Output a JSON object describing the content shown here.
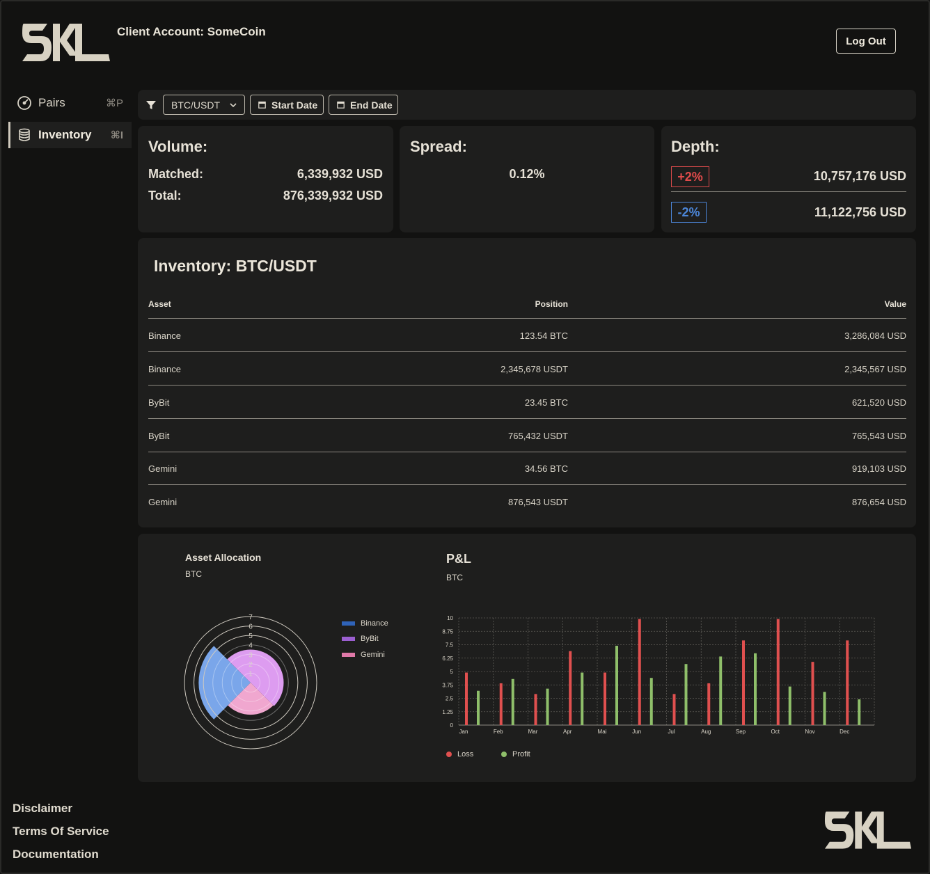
{
  "header": {
    "logo_text": "SKL",
    "client_account": "Client Account: SomeCoin",
    "logout_label": "Log Out"
  },
  "sidebar": {
    "items": [
      {
        "label": "Pairs",
        "shortcut": "⌘P",
        "icon": "gauge-icon",
        "active": false
      },
      {
        "label": "Inventory",
        "shortcut": "⌘I",
        "icon": "database-icon",
        "active": true
      }
    ]
  },
  "footer": {
    "links": [
      "Disclaimer",
      "Terms Of Service",
      "Documentation"
    ],
    "logo_text": "SKL"
  },
  "filters": {
    "pair_value": "BTC/USDT",
    "start_label": "Start Date",
    "end_label": "End Date"
  },
  "volume": {
    "title": "Volume:",
    "matched_label": "Matched:",
    "matched_value": "6,339,932 USD",
    "total_label": "Total:",
    "total_value": "876,339,932 USD"
  },
  "spread": {
    "title": "Spread:",
    "value": "0.12%"
  },
  "depth": {
    "title": "Depth:",
    "up_badge": "+2%",
    "up_value": "10,757,176  USD",
    "down_badge": "-2%",
    "down_value": "11,122,756  USD"
  },
  "inventory": {
    "title": "Inventory: BTC/USDT",
    "columns": [
      "Asset",
      "Position",
      "Value"
    ],
    "rows": [
      {
        "asset": "Binance",
        "position": "123.54 BTC",
        "value": "3,286,084 USD"
      },
      {
        "asset": "Binance",
        "position": "2,345,678 USDT",
        "value": "2,345,567 USD"
      },
      {
        "asset": "ByBit",
        "position": "23.45 BTC",
        "value": "621,520 USD"
      },
      {
        "asset": "ByBit",
        "position": "765,432 USDT",
        "value": "765,543 USD"
      },
      {
        "asset": "Gemini",
        "position": "34.56 BTC",
        "value": "919,103 USD"
      },
      {
        "asset": "Gemini",
        "position": "876,543 USDT",
        "value": "876,654 USD"
      }
    ]
  },
  "colors": {
    "accent": "#d8d3c7",
    "loss": "#e0504f",
    "profit": "#8fbf6a",
    "binance": "#2f63b8",
    "bybit": "#9b5fd0",
    "gemini": "#e079a8"
  },
  "chart_data": [
    {
      "type": "polar-area",
      "title": "Asset Allocation",
      "subtitle": "BTC",
      "radial_ticks": [
        1,
        2,
        3,
        4,
        5,
        6,
        7
      ],
      "rlim": [
        0,
        7
      ],
      "legend_position": "right",
      "series": [
        {
          "name": "Binance",
          "value": 5.5,
          "color": "#7aa6ea"
        },
        {
          "name": "ByBit",
          "value": 3.5,
          "color": "#dd9cf0"
        },
        {
          "name": "Gemini",
          "value": 3.4,
          "color": "#f0a7cf"
        }
      ]
    },
    {
      "type": "bar",
      "title": "P&L",
      "subtitle": "BTC",
      "categories": [
        "Jan",
        "Feb",
        "Mar",
        "Apr",
        "Mai",
        "Jun",
        "Jul",
        "Aug",
        "Sep",
        "Oct",
        "Nov",
        "Dec"
      ],
      "y_ticks": [
        "0",
        "1.25",
        "2.5",
        "3.75",
        "5",
        "6.25",
        "7.5",
        "8.75",
        "10"
      ],
      "ylim": [
        0,
        10
      ],
      "grid": true,
      "legend_position": "bottom-left",
      "series": [
        {
          "name": "Loss",
          "color": "#e0504f",
          "values": [
            4.9,
            3.9,
            2.9,
            6.9,
            4.9,
            9.9,
            2.9,
            3.9,
            7.9,
            9.9,
            5.9,
            7.9
          ]
        },
        {
          "name": "Profit",
          "color": "#8fbf6a",
          "values": [
            3.2,
            4.3,
            3.4,
            4.9,
            7.4,
            4.4,
            5.7,
            6.4,
            6.7,
            3.6,
            3.1,
            2.4
          ]
        }
      ]
    }
  ]
}
